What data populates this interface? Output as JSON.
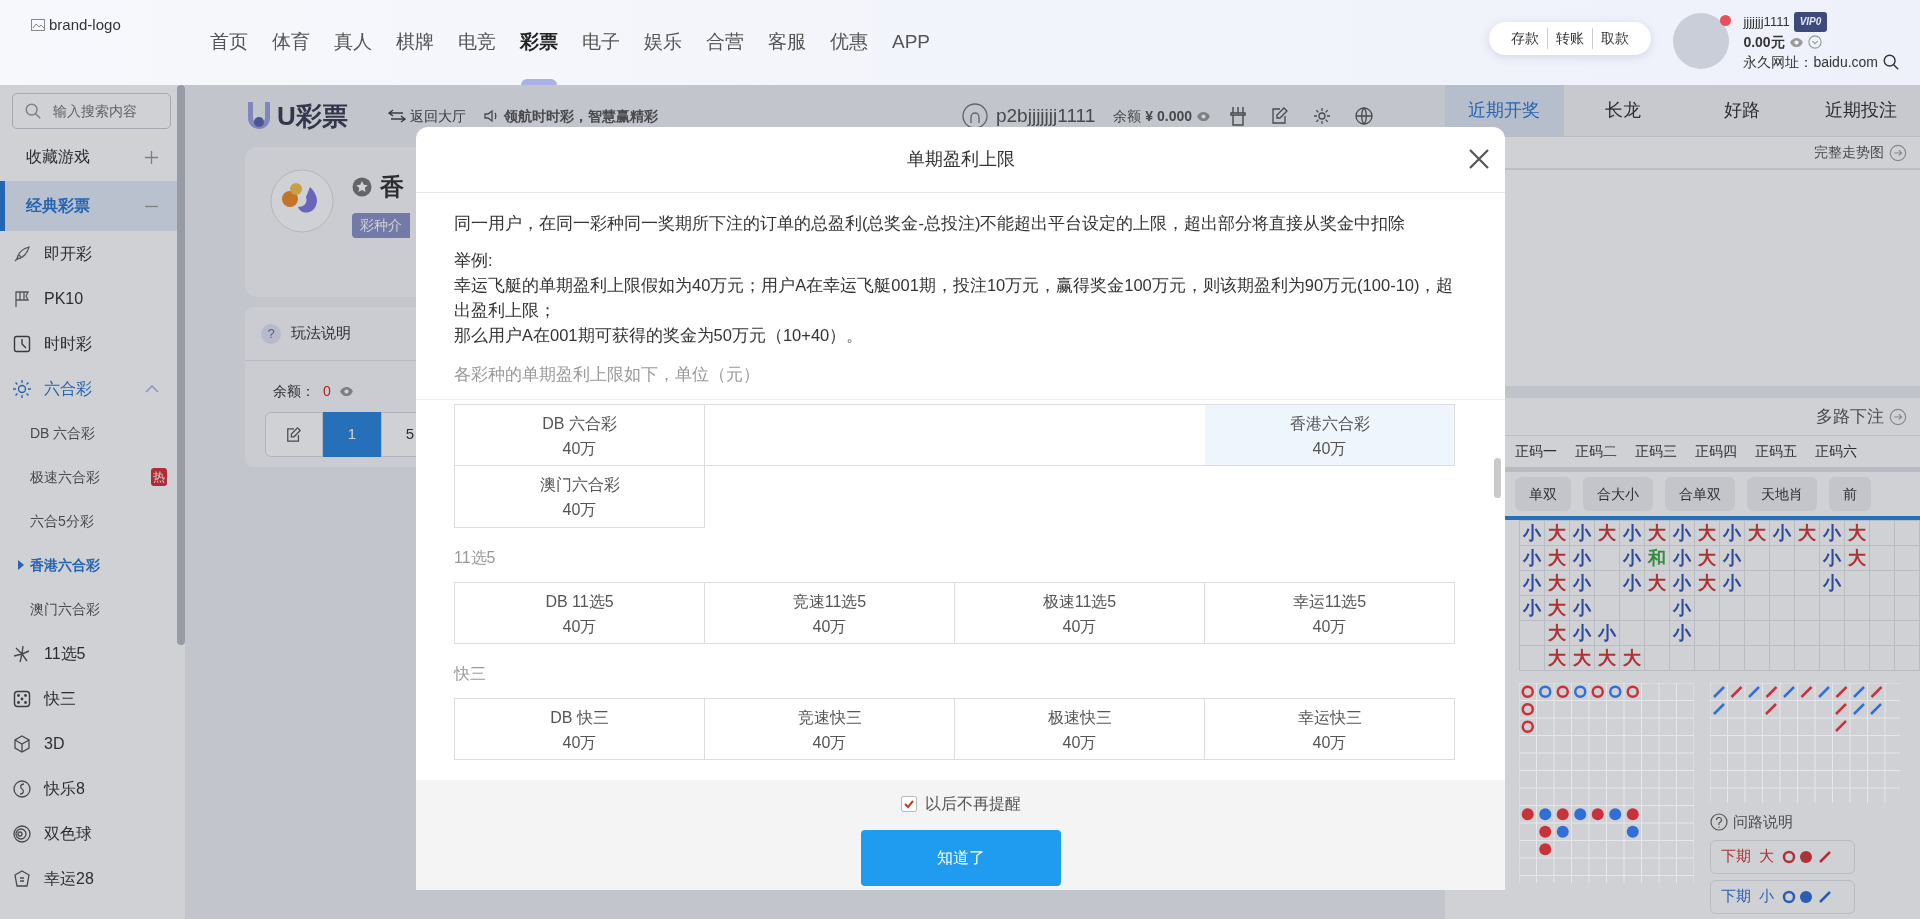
{
  "header": {
    "brand_logo_alt": "brand-logo",
    "nav": [
      {
        "label": "首页",
        "selected": false
      },
      {
        "label": "体育",
        "selected": false
      },
      {
        "label": "真人",
        "selected": false
      },
      {
        "label": "棋牌",
        "selected": false
      },
      {
        "label": "电竞",
        "selected": false
      },
      {
        "label": "彩票",
        "selected": true
      },
      {
        "label": "电子",
        "selected": false
      },
      {
        "label": "娱乐",
        "selected": false
      },
      {
        "label": "合营",
        "selected": false
      },
      {
        "label": "客服",
        "selected": false
      },
      {
        "label": "优惠",
        "selected": false
      },
      {
        "label": "APP",
        "selected": false
      }
    ],
    "wallet_actions": [
      "存款",
      "转账",
      "取款"
    ],
    "user": {
      "username": "jjjjjjj1111",
      "vip": "VIP0",
      "balance": "0.00元",
      "has_notification": true,
      "site": "永久网址：baidu.com"
    }
  },
  "sidebar": {
    "search": {
      "placeholder": "输入搜索内容"
    },
    "favorites": {
      "label": "收藏游戏"
    },
    "category": {
      "label": "经典彩票",
      "expanded": true
    },
    "items": [
      {
        "label": "即开彩",
        "expanded": false
      },
      {
        "label": "PK10",
        "expanded": false
      },
      {
        "label": "时时彩",
        "expanded": false
      },
      {
        "label": "六合彩",
        "expanded": true,
        "children": [
          {
            "label": "DB 六合彩",
            "selected": false
          },
          {
            "label": "极速六合彩",
            "badge": "热",
            "selected": false
          },
          {
            "label": "六合5分彩",
            "selected": false
          },
          {
            "label": "香港六合彩",
            "selected": true
          },
          {
            "label": "澳门六合彩",
            "selected": false
          }
        ]
      },
      {
        "label": "11选5",
        "expanded": false
      },
      {
        "label": "快三",
        "expanded": false
      },
      {
        "label": "3D",
        "expanded": false
      },
      {
        "label": "快乐8",
        "expanded": false
      },
      {
        "label": "双色球",
        "expanded": false
      },
      {
        "label": "幸运28",
        "expanded": false
      }
    ]
  },
  "lottery_bar": {
    "title": "U彩票",
    "back": "返回大厅",
    "slogan": "领航时时彩，智慧赢精彩",
    "account": "p2bjjjjjjj1111",
    "balance_label": "余额",
    "balance": "¥ 0.000"
  },
  "game_card": {
    "name": "香",
    "intro_tag": "彩种介"
  },
  "play": {
    "help_icon": "?",
    "help": "玩法说明",
    "balance_label": "余额：",
    "balance": "0",
    "multipliers": [
      {
        "label": "1",
        "selected": true
      },
      {
        "label": "5",
        "selected": false
      }
    ]
  },
  "modal": {
    "title": "单期盈利上限",
    "intro": "同一用户，在同一彩种同一奖期所下注的订单的总盈利(总奖金-总投注)不能超出平台设定的上限，超出部分将直接从奖金中扣除",
    "example_label": "举例:",
    "example_lines": [
      "幸运飞艇的单期盈利上限假如为40万元；用户A在幸运飞艇001期，投注10万元，赢得奖金100万元，则该期盈利为90万元(100-10)，超出盈利上限；",
      "那么用户A在001期可获得的奖金为50万元（10+40）。"
    ],
    "note": "各彩种的单期盈利上限如下，单位（元）",
    "groups": [
      {
        "items": [
          {
            "kind": "game",
            "name": "DB 六合彩",
            "limit": "40万",
            "highlighted": false
          },
          {
            "kind": "blank"
          },
          {
            "kind": "blank"
          },
          {
            "kind": "game",
            "name": "香港六合彩",
            "limit": "40万",
            "highlighted": true
          },
          {
            "kind": "game",
            "name": "澳门六合彩",
            "limit": "40万",
            "highlighted": false
          }
        ]
      },
      {
        "title": "11选5",
        "items": [
          {
            "kind": "game",
            "name": "DB 11选5",
            "limit": "40万",
            "highlighted": false
          },
          {
            "kind": "game",
            "name": "竞速11选5",
            "limit": "40万",
            "highlighted": false
          },
          {
            "kind": "game",
            "name": "极速11选5",
            "limit": "40万",
            "highlighted": false
          },
          {
            "kind": "game",
            "name": "幸运11选5",
            "limit": "40万",
            "highlighted": false
          }
        ]
      },
      {
        "title": "快三",
        "items": [
          {
            "kind": "game",
            "name": "DB 快三",
            "limit": "40万",
            "highlighted": false
          },
          {
            "kind": "game",
            "name": "竞速快三",
            "limit": "40万",
            "highlighted": false
          },
          {
            "kind": "game",
            "name": "极速快三",
            "limit": "40万",
            "highlighted": false
          },
          {
            "kind": "game",
            "name": "幸运快三",
            "limit": "40万",
            "highlighted": false
          }
        ]
      }
    ],
    "dont_remind": {
      "label": "以后不再提醒",
      "checked": true
    },
    "confirm": "知道了"
  },
  "right_panel": {
    "tabs": [
      {
        "label": "近期开奖",
        "selected": true
      },
      {
        "label": "长龙",
        "selected": false
      },
      {
        "label": "好路",
        "selected": false
      },
      {
        "label": "近期投注",
        "selected": false
      }
    ],
    "trend_link": "完整走势图",
    "multi_bet_link": "多路下注",
    "position_tabs": [
      "正码一",
      "正码二",
      "正码三",
      "正码四",
      "正码五",
      "正码六"
    ],
    "road_types": [
      "单双",
      "合大小",
      "合单双",
      "天地肖",
      "前"
    ],
    "big_road": [
      [
        {
          "kind": "mark",
          "text": "小",
          "color": "#2e4a9b"
        },
        {
          "kind": "mark",
          "text": "大",
          "color": "#ac3336"
        },
        {
          "kind": "mark",
          "text": "小",
          "color": "#2e4a9b"
        },
        {
          "kind": "mark",
          "text": "大",
          "color": "#ac3336"
        },
        {
          "kind": "mark",
          "text": "小",
          "color": "#2e4a9b"
        },
        {
          "kind": "mark",
          "text": "大",
          "color": "#ac3336"
        },
        {
          "kind": "mark",
          "text": "小",
          "color": "#2e4a9b"
        },
        {
          "kind": "mark",
          "text": "大",
          "color": "#ac3336"
        },
        {
          "kind": "mark",
          "text": "小",
          "color": "#2e4a9b"
        },
        {
          "kind": "mark",
          "text": "大",
          "color": "#ac3336"
        },
        {
          "kind": "mark",
          "text": "小",
          "color": "#2e4a9b"
        },
        {
          "kind": "mark",
          "text": "大",
          "color": "#ac3336"
        },
        {
          "kind": "mark",
          "text": "小",
          "color": "#2e4a9b"
        },
        {
          "kind": "mark",
          "text": "大",
          "color": "#ac3336"
        }
      ],
      [
        {
          "kind": "mark",
          "text": "小",
          "color": "#2e4a9b"
        },
        {
          "kind": "mark",
          "text": "大",
          "color": "#ac3336"
        },
        {
          "kind": "mark",
          "text": "小",
          "color": "#2e4a9b"
        },
        {
          "kind": "blank"
        },
        {
          "kind": "mark",
          "text": "小",
          "color": "#2e4a9b"
        },
        {
          "kind": "mark",
          "text": "和",
          "color": "#328b3f"
        },
        {
          "kind": "mark",
          "text": "小",
          "color": "#2e4a9b"
        },
        {
          "kind": "mark",
          "text": "大",
          "color": "#ac3336"
        },
        {
          "kind": "mark",
          "text": "小",
          "color": "#2e4a9b"
        },
        {
          "kind": "blank"
        },
        {
          "kind": "blank"
        },
        {
          "kind": "blank"
        },
        {
          "kind": "mark",
          "text": "小",
          "color": "#2e4a9b"
        },
        {
          "kind": "mark",
          "text": "大",
          "color": "#ac3336"
        }
      ],
      [
        {
          "kind": "mark",
          "text": "小",
          "color": "#2e4a9b"
        },
        {
          "kind": "mark",
          "text": "大",
          "color": "#ac3336"
        },
        {
          "kind": "mark",
          "text": "小",
          "color": "#2e4a9b"
        },
        {
          "kind": "blank"
        },
        {
          "kind": "mark",
          "text": "小",
          "color": "#2e4a9b"
        },
        {
          "kind": "mark",
          "text": "大",
          "color": "#ac3336"
        },
        {
          "kind": "mark",
          "text": "小",
          "color": "#2e4a9b"
        },
        {
          "kind": "mark",
          "text": "大",
          "color": "#ac3336"
        },
        {
          "kind": "mark",
          "text": "小",
          "color": "#2e4a9b"
        },
        {
          "kind": "blank"
        },
        {
          "kind": "blank"
        },
        {
          "kind": "blank"
        },
        {
          "kind": "mark",
          "text": "小",
          "color": "#2e4a9b"
        }
      ],
      [
        {
          "kind": "mark",
          "text": "小",
          "color": "#2e4a9b"
        },
        {
          "kind": "mark",
          "text": "大",
          "color": "#ac3336"
        },
        {
          "kind": "mark",
          "text": "小",
          "color": "#2e4a9b"
        },
        {
          "kind": "blank"
        },
        {
          "kind": "blank"
        },
        {
          "kind": "blank"
        },
        {
          "kind": "mark",
          "text": "小",
          "color": "#2e4a9b"
        }
      ],
      [
        {
          "kind": "blank"
        },
        {
          "kind": "mark",
          "text": "大",
          "color": "#ac3336"
        },
        {
          "kind": "mark",
          "text": "小",
          "color": "#2e4a9b"
        },
        {
          "kind": "mark",
          "text": "小",
          "color": "#2e4a9b"
        },
        {
          "kind": "blank"
        },
        {
          "kind": "blank"
        },
        {
          "kind": "mark",
          "text": "小",
          "color": "#2e4a9b"
        }
      ],
      [
        {
          "kind": "blank"
        },
        {
          "kind": "mark",
          "text": "大",
          "color": "#ac3336"
        },
        {
          "kind": "mark",
          "text": "大",
          "color": "#ac3336"
        },
        {
          "kind": "mark",
          "text": "大",
          "color": "#ac3336"
        },
        {
          "kind": "mark",
          "text": "大",
          "color": "#ac3336"
        }
      ]
    ],
    "ask_road": {
      "label": "问路说明",
      "predictions": [
        {
          "label": "下期",
          "result": "大",
          "color": "#ac3336"
        },
        {
          "label": "下期",
          "result": "小",
          "color": "#2a5eb3"
        }
      ]
    }
  }
}
